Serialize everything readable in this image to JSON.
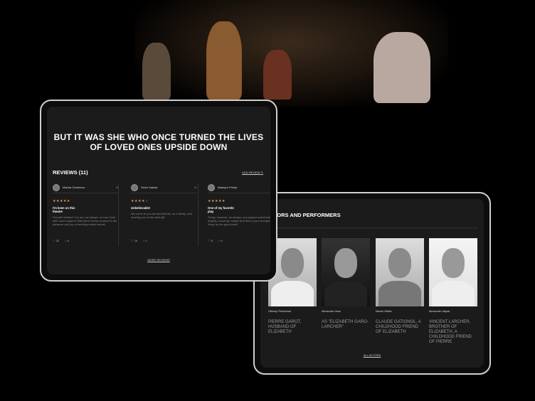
{
  "hero": {
    "headline": "BUT IT WAS SHE WHO ONCE TURNED THE LIVES OF LOVED ONES UPSIDE DOWN"
  },
  "reviews": {
    "title": "REVIEWS (11)",
    "add_label": "ADD REVIEW",
    "more_label": "MORE REVIEWS",
    "items": [
      {
        "author": "Marina Gordeeva",
        "stars": "★★★★★",
        "title": "I'm keen on this theatre",
        "text": "Favorite theater! You are, as always, on top! Such skill, such a game! Well done! Every moment is the pleasure and joy of meeting native actors!",
        "likes": "32",
        "comments": "6"
      },
      {
        "author": "Victor Vakula",
        "stars": "★★★★☆",
        "title": "Unbelievable!",
        "text": "We come to you as best friends, as a family, and meeting you is the best gift",
        "likes": "16",
        "comments": "2"
      },
      {
        "author": "Maksym Portyk",
        "stars": "★★★★★",
        "title": "One of my favorite play",
        "text": "Today, however, as always, you played wonderfully, brightly, sincerely, easily! And this is your strength! Keep up the good work!",
        "likes": "8",
        "comments": "0"
      }
    ]
  },
  "actors": {
    "title": "ACTORS AND PERFORMERS",
    "all_label": "ALL ACTORS",
    "items": [
      {
        "name": "Oleksiy Polishchuk",
        "role": "Pierre Garot, husband of Elizabeth"
      },
      {
        "name": "Alexandra Yana",
        "role": "as \"Elizabeth Garo-Larcher\""
      },
      {
        "name": "Maxim Nikitin",
        "role": "Claude Gatignol, a childhood friend of Elizabeth"
      },
      {
        "name": "Alexander Valyuk",
        "role": "Vincent Larcher, brother of Elizabeth, a childhood friend of Pierre"
      }
    ]
  }
}
